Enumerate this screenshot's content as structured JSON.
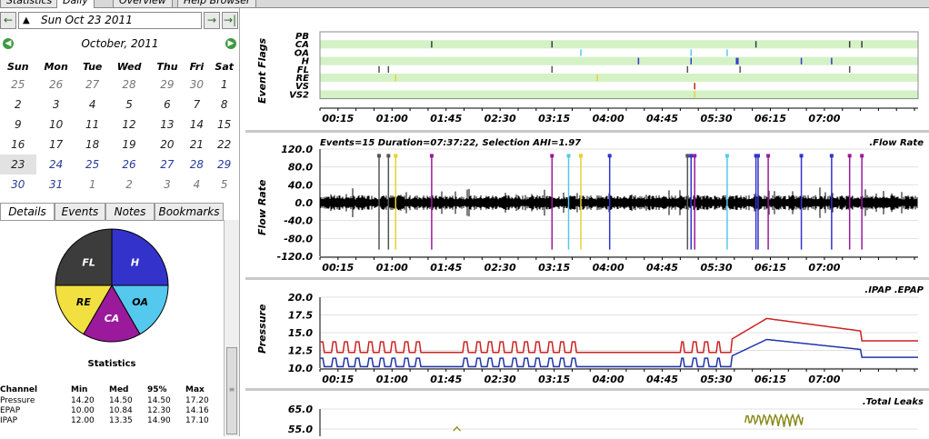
{
  "top_tabs": [
    {
      "label": "Statistics"
    },
    {
      "label": "Daily"
    },
    {
      "label": "Overview"
    },
    {
      "label": "Help Browser"
    }
  ],
  "date_nav": {
    "prev_icon": "arrow-left-icon",
    "date": "Sun Oct 23 2011",
    "next_icon": "arrow-right-icon",
    "last_icon": "arrow-right-bar-icon"
  },
  "calendar": {
    "month": "October",
    "year": "2011",
    "month_label": "October,  2011",
    "weekdays": [
      "Sun",
      "Mon",
      "Tue",
      "Wed",
      "Thu",
      "Fri",
      "Sat"
    ],
    "weeks": [
      [
        "25",
        "26",
        "27",
        "28",
        "29",
        "30",
        "1"
      ],
      [
        "2",
        "3",
        "4",
        "5",
        "6",
        "7",
        "8"
      ],
      [
        "9",
        "10",
        "11",
        "12",
        "13",
        "14",
        "15"
      ],
      [
        "16",
        "17",
        "18",
        "19",
        "20",
        "21",
        "22"
      ],
      [
        "23",
        "24",
        "25",
        "26",
        "27",
        "28",
        "29"
      ],
      [
        "30",
        "31",
        "1",
        "2",
        "3",
        "4",
        "5"
      ]
    ],
    "selected": "23"
  },
  "sub_tabs": [
    {
      "label": "Details"
    },
    {
      "label": "Events"
    },
    {
      "label": "Notes"
    },
    {
      "label": "Bookmarks"
    }
  ],
  "pie": {
    "slices": [
      {
        "label": "H",
        "fraction": 0.25,
        "color": "#3333cc"
      },
      {
        "label": "OA",
        "fraction": 0.1667,
        "color": "#55c8ee"
      },
      {
        "label": "CA",
        "fraction": 0.1667,
        "color": "#9b1a9b"
      },
      {
        "label": "RE",
        "fraction": 0.1667,
        "color": "#f2e040"
      },
      {
        "label": "FL",
        "fraction": 0.25,
        "color": "#3c3c3c"
      }
    ]
  },
  "statistics": {
    "title": "Statistics",
    "columns": [
      "Channel",
      "Min",
      "Med",
      "95%",
      "Max"
    ],
    "rows": [
      [
        "Pressure",
        "14.20",
        "14.50",
        "14.50",
        "17.20"
      ],
      [
        "EPAP",
        "10.00",
        "10.84",
        "12.30",
        "14.16"
      ],
      [
        "IPAP",
        "12.00",
        "13.35",
        "14.90",
        "17.10"
      ]
    ]
  },
  "event_flags": {
    "ylabel": "Event Flags",
    "rows": [
      "PB",
      "CA",
      "OA",
      "H",
      "FL",
      "RE",
      "VS",
      "VS2"
    ],
    "row_colors": [
      "#ffffff",
      "#d4f2c6",
      "#ffffff",
      "#d4f2c6",
      "#ffffff",
      "#d4f2c6",
      "#ffffff",
      "#d4f2c6"
    ],
    "events": [
      {
        "row": "CA",
        "t": 1.55,
        "color": "#3c3c3c"
      },
      {
        "row": "CA",
        "t": 3.22,
        "color": "#3c3c3c"
      },
      {
        "row": "CA",
        "t": 6.05,
        "color": "#3c3c3c"
      },
      {
        "row": "CA",
        "t": 7.35,
        "color": "#3c3c3c"
      },
      {
        "row": "CA",
        "t": 7.52,
        "color": "#3c3c3c"
      },
      {
        "row": "OA",
        "t": 3.62,
        "color": "#55c8ee"
      },
      {
        "row": "OA",
        "t": 5.15,
        "color": "#55c8ee"
      },
      {
        "row": "OA",
        "t": 5.65,
        "color": "#55c8ee"
      },
      {
        "row": "H",
        "t": 4.42,
        "color": "#3333cc"
      },
      {
        "row": "H",
        "t": 5.15,
        "color": "#3333cc"
      },
      {
        "row": "H",
        "t": 5.78,
        "color": "#3333cc"
      },
      {
        "row": "H",
        "t": 5.8,
        "color": "#3333cc"
      },
      {
        "row": "H",
        "t": 6.68,
        "color": "#3333cc"
      },
      {
        "row": "H",
        "t": 7.1,
        "color": "#3333cc"
      },
      {
        "row": "FL",
        "t": 0.82,
        "color": "#555555"
      },
      {
        "row": "FL",
        "t": 0.95,
        "color": "#555555"
      },
      {
        "row": "FL",
        "t": 3.22,
        "color": "#555555"
      },
      {
        "row": "FL",
        "t": 5.1,
        "color": "#555555"
      },
      {
        "row": "FL",
        "t": 5.83,
        "color": "#555555"
      },
      {
        "row": "FL",
        "t": 7.35,
        "color": "#555555"
      },
      {
        "row": "RE",
        "t": 1.05,
        "color": "#e8d030"
      },
      {
        "row": "RE",
        "t": 3.85,
        "color": "#e8d030"
      },
      {
        "row": "VS",
        "t": 5.2,
        "color": "#cc2222"
      },
      {
        "row": "VS2",
        "t": 5.2,
        "color": "#e8d030"
      }
    ]
  },
  "time_axis": {
    "labels": [
      "00:15",
      "01:00",
      "01:45",
      "02:30",
      "03:15",
      "04:00",
      "04:45",
      "05:30",
      "06:15",
      "07:00"
    ],
    "start": 0,
    "end": 8.3
  },
  "flow_rate": {
    "ylabel": "Flow Rate",
    "legend": ".Flow Rate",
    "header": "Events=15 Duration=07:37:22, Selection AHI=1.97",
    "yticks": [
      "120.0",
      "80.0",
      "40.0",
      "0.0",
      "-40.0",
      "-80.0",
      "-120.0"
    ],
    "ylim": [
      -120,
      120
    ],
    "markers": [
      {
        "t": 0.82,
        "color": "#555555"
      },
      {
        "t": 0.95,
        "color": "#555555"
      },
      {
        "t": 1.05,
        "color": "#e8d030"
      },
      {
        "t": 1.55,
        "color": "#9b1a9b"
      },
      {
        "t": 3.22,
        "color": "#9b1a9b"
      },
      {
        "t": 3.45,
        "color": "#55c8ee"
      },
      {
        "t": 3.62,
        "color": "#e8d030"
      },
      {
        "t": 4.02,
        "color": "#3333cc"
      },
      {
        "t": 5.1,
        "color": "#555555"
      },
      {
        "t": 5.15,
        "color": "#3333cc"
      },
      {
        "t": 5.2,
        "color": "#9b1a9b"
      },
      {
        "t": 5.65,
        "color": "#55c8ee"
      },
      {
        "t": 6.05,
        "color": "#3333cc"
      },
      {
        "t": 6.08,
        "color": "#3333cc"
      },
      {
        "t": 6.22,
        "color": "#9b1a9b"
      },
      {
        "t": 6.68,
        "color": "#3333cc"
      },
      {
        "t": 7.1,
        "color": "#3333cc"
      },
      {
        "t": 7.35,
        "color": "#9b1a9b"
      },
      {
        "t": 7.52,
        "color": "#9b1a9b"
      }
    ]
  },
  "pressure": {
    "ylabel": "Pressure",
    "legend": ".IPAP .EPAP",
    "yticks": [
      "20.0",
      "17.5",
      "15.0",
      "12.5",
      "10.0"
    ],
    "ylim": [
      10,
      20
    ],
    "ipap_color": "#cc2222",
    "epap_color": "#2233aa"
  },
  "leaks": {
    "legend": ".Total Leaks",
    "yticks": [
      "65.0",
      "55.0"
    ],
    "ylim": [
      45,
      65
    ],
    "color": "#888a1a"
  }
}
